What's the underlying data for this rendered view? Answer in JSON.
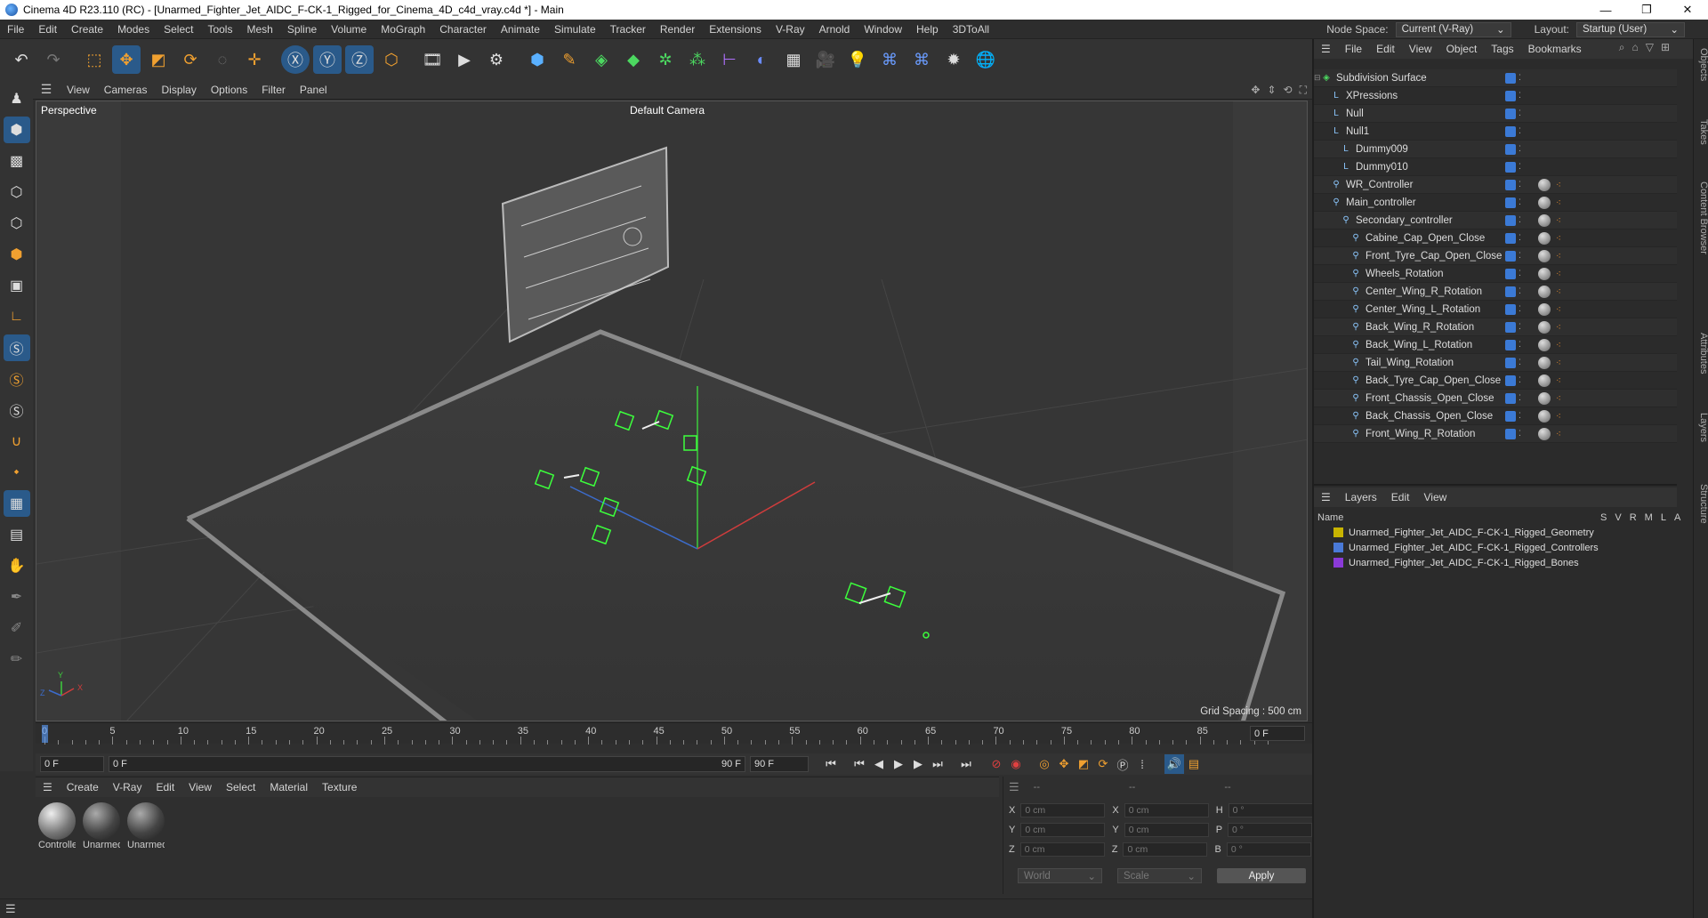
{
  "window": {
    "title": "Cinema 4D R23.110 (RC) - [Unarmed_Fighter_Jet_AIDC_F-CK-1_Rigged_for_Cinema_4D_c4d_vray.c4d *] - Main"
  },
  "menu": [
    "File",
    "Edit",
    "Create",
    "Modes",
    "Select",
    "Tools",
    "Mesh",
    "Spline",
    "Volume",
    "MoGraph",
    "Character",
    "Animate",
    "Simulate",
    "Tracker",
    "Render",
    "Extensions",
    "V-Ray",
    "Arnold",
    "Window",
    "Help",
    "3DToAll"
  ],
  "nodespace": {
    "label": "Node Space:",
    "value": "Current (V-Ray)",
    "layout_label": "Layout:",
    "layout_value": "Startup (User)"
  },
  "viewport": {
    "menu": [
      "View",
      "Cameras",
      "Display",
      "Options",
      "Filter",
      "Panel"
    ],
    "label": "Perspective",
    "camera": "Default Camera",
    "grid_spacing": "Grid Spacing : 500 cm"
  },
  "timeline": {
    "ticks": [
      "0",
      "5",
      "10",
      "15",
      "20",
      "25",
      "30",
      "35",
      "40",
      "45",
      "50",
      "55",
      "60",
      "65",
      "70",
      "75",
      "80",
      "85",
      "90"
    ],
    "current": "0 F"
  },
  "playbar": {
    "start": "0 F",
    "range_start": "0 F",
    "range_end": "90 F",
    "end": "90 F"
  },
  "materials": {
    "menu": [
      "Create",
      "V-Ray",
      "Edit",
      "View",
      "Select",
      "Material",
      "Texture"
    ],
    "items": [
      "Controlle",
      "Unarmed",
      "Unarmed"
    ]
  },
  "coords": {
    "headers": [
      "--",
      "--",
      "--"
    ],
    "rows": [
      {
        "a": "X",
        "av": "0 cm",
        "b": "X",
        "bv": "0 cm",
        "c": "H",
        "cv": "0 °"
      },
      {
        "a": "Y",
        "av": "0 cm",
        "b": "Y",
        "bv": "0 cm",
        "c": "P",
        "cv": "0 °"
      },
      {
        "a": "Z",
        "av": "0 cm",
        "b": "Z",
        "bv": "0 cm",
        "c": "B",
        "cv": "0 °"
      }
    ],
    "space": "World",
    "mode": "Scale",
    "apply": "Apply"
  },
  "objects": {
    "menu": [
      "File",
      "Edit",
      "View",
      "Object",
      "Tags",
      "Bookmarks"
    ],
    "items": [
      {
        "name": "Subdivision Surface",
        "indent": 0
      },
      {
        "name": "XPressions",
        "indent": 1
      },
      {
        "name": "Null",
        "indent": 1
      },
      {
        "name": "Null1",
        "indent": 1
      },
      {
        "name": "Dummy009",
        "indent": 2
      },
      {
        "name": "Dummy010",
        "indent": 2
      },
      {
        "name": "WR_Controller",
        "indent": 1
      },
      {
        "name": "Main_controller",
        "indent": 1
      },
      {
        "name": "Secondary_controller",
        "indent": 2
      },
      {
        "name": "Cabine_Cap_Open_Close",
        "indent": 3
      },
      {
        "name": "Front_Tyre_Cap_Open_Close",
        "indent": 3
      },
      {
        "name": "Wheels_Rotation",
        "indent": 3
      },
      {
        "name": "Center_Wing_R_Rotation",
        "indent": 3
      },
      {
        "name": "Center_Wing_L_Rotation",
        "indent": 3
      },
      {
        "name": "Back_Wing_R_Rotation",
        "indent": 3
      },
      {
        "name": "Back_Wing_L_Rotation",
        "indent": 3
      },
      {
        "name": "Tail_Wing_Rotation",
        "indent": 3
      },
      {
        "name": "Back_Tyre_Cap_Open_Close",
        "indent": 3
      },
      {
        "name": "Front_Chassis_Open_Close",
        "indent": 3
      },
      {
        "name": "Back_Chassis_Open_Close",
        "indent": 3
      },
      {
        "name": "Front_Wing_R_Rotation",
        "indent": 3
      }
    ]
  },
  "layers": {
    "menu": [
      "Layers",
      "Edit",
      "View"
    ],
    "header": {
      "name": "Name",
      "cols": [
        "S",
        "V",
        "R",
        "M",
        "L",
        "A"
      ]
    },
    "items": [
      {
        "name": "Unarmed_Fighter_Jet_AIDC_F-CK-1_Rigged_Geometry",
        "color": "#c8b400"
      },
      {
        "name": "Unarmed_Fighter_Jet_AIDC_F-CK-1_Rigged_Controllers",
        "color": "#4a7ad8"
      },
      {
        "name": "Unarmed_Fighter_Jet_AIDC_F-CK-1_Rigged_Bones",
        "color": "#8a3ad8"
      }
    ]
  },
  "side_tabs": [
    "Objects",
    "Takes",
    "Content Browser",
    "Attributes",
    "Layers",
    "Structure"
  ]
}
